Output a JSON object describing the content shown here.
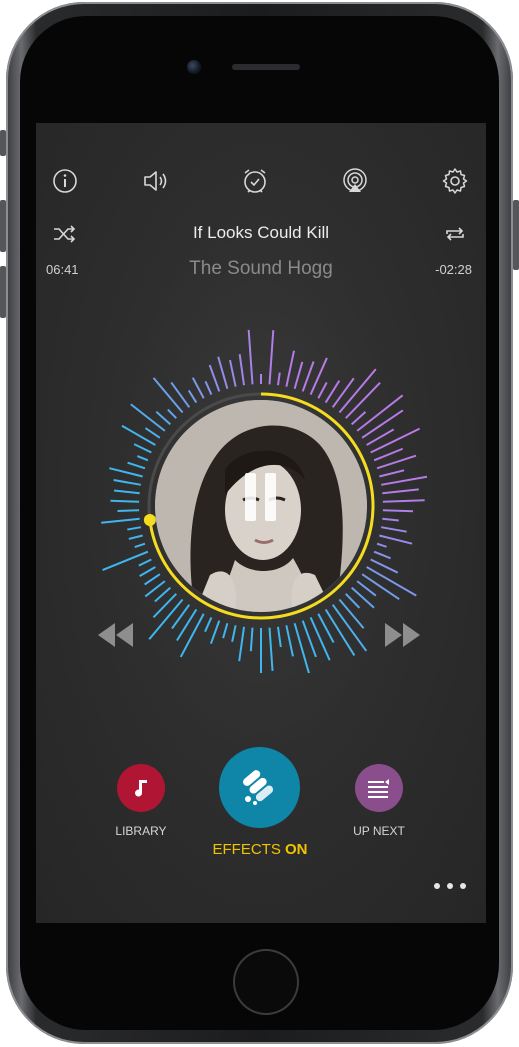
{
  "top_bar": {
    "icons": [
      "info-icon",
      "volume-icon",
      "alarm-clock-icon",
      "airplay-icon",
      "settings-gear-icon"
    ]
  },
  "now_playing": {
    "title": "If Looks Could Kill",
    "artist": "The Sound Hogg",
    "elapsed": "06:41",
    "remaining": "-02:28",
    "progress": 0.73
  },
  "controls": {
    "shuffle_icon": "shuffle-icon",
    "repeat_icon": "repeat-icon",
    "rewind_icon": "rewind-icon",
    "forward_icon": "fast-forward-icon",
    "pause_icon": "pause-icon"
  },
  "bottom": {
    "library_label": "LIBRARY",
    "effects_label": "EFFECTS",
    "effects_state": "ON",
    "upnext_label": "UP NEXT"
  },
  "colors": {
    "progress_ring": "#f5dc1e",
    "library": "#b01633",
    "effects": "#0f86a8",
    "upnext": "#8a4e8c",
    "effects_text": "#f2c400",
    "spectrum_start": "#3fb6ee",
    "spectrum_end": "#b77ae6"
  }
}
